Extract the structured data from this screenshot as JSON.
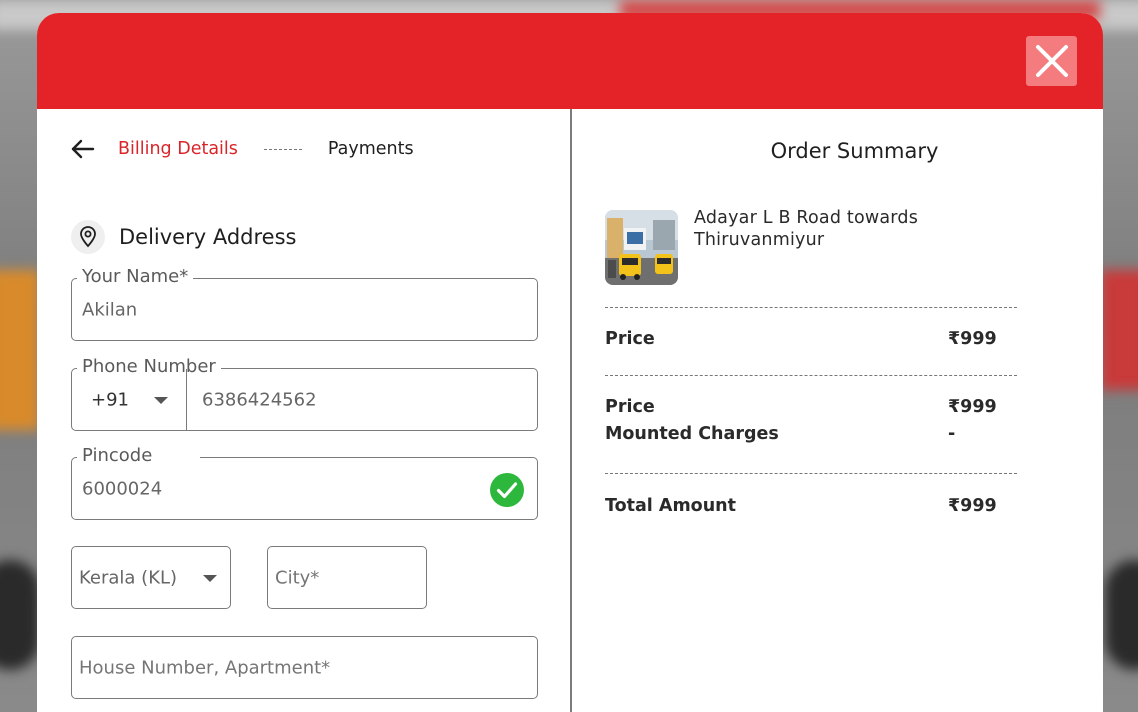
{
  "header": {
    "close_icon": "close-icon"
  },
  "steps": {
    "active": "Billing Details",
    "next": "Payments"
  },
  "delivery": {
    "title": "Delivery Address",
    "name": {
      "label": "Your Name*",
      "value": "Akilan"
    },
    "phone": {
      "label": "Phone Number",
      "code": "+91",
      "value": "6386424562"
    },
    "pincode": {
      "label": "Pincode",
      "value": "6000024"
    },
    "state": {
      "value": "Kerala (KL)"
    },
    "city": {
      "placeholder": "City*"
    },
    "house": {
      "placeholder": "House Number, Apartment*"
    }
  },
  "summary": {
    "title": "Order Summary",
    "location_line1": "Adayar L B Road towards",
    "location_line2": "Thiruvanmiyur",
    "price_label": "Price",
    "price_value": "₹999",
    "price2_label": "Price",
    "price2_value": "₹999",
    "mounted_label": "Mounted Charges",
    "mounted_value": "-",
    "total_label": "Total Amount",
    "total_value": "₹999"
  },
  "colors": {
    "brand": "#e42328",
    "check": "#2db83d"
  }
}
